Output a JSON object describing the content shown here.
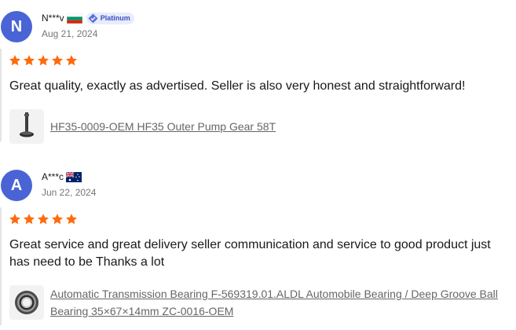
{
  "reviews": [
    {
      "initial": "N",
      "name": "N***v",
      "flag_icon": "bulgaria-flag-icon",
      "badge": "Platinum",
      "date": "Aug 21, 2024",
      "rating": 5,
      "text": "Great quality, exactly as advertised. Seller is also very honest and straightforward!",
      "product": "HF35-0009-OEM HF35 Outer Pump Gear 58T"
    },
    {
      "initial": "A",
      "name": "A***c",
      "flag_icon": "australia-flag-icon",
      "date": "Jun 22, 2024",
      "rating": 5,
      "text": "Great service and great delivery seller communication and service to good product just has need to be Thanks a lot",
      "product": "Automatic Transmission Bearing F-569319.01.ALDL Automobile Bearing / Deep Groove Ball Bearing 35×67×14mm ZC-0016-OEM"
    }
  ],
  "colors": {
    "avatar": "#4a64d6",
    "star": "#fd6b0d",
    "badge_bg": "#e8ecfb",
    "badge_text": "#3a4fc3"
  }
}
